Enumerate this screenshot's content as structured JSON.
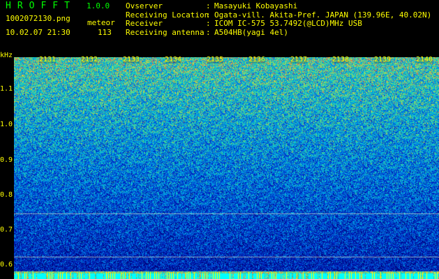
{
  "header": {
    "app_title": "HROFFT",
    "version": "1.0.0",
    "filename": "1002072130.png",
    "mode": "meteor",
    "datetime": "10.02.07 21:30",
    "count": "113"
  },
  "info": [
    {
      "label": "Ovserver",
      "colon": ":",
      "value": "Masayuki Kobayashi"
    },
    {
      "label": "Receiving Location",
      "colon": ":",
      "value": "Ogata-vill. Akita-Pref. JAPAN (139.96E, 40.02N)"
    },
    {
      "label": "Receiver",
      "colon": ":",
      "value": "ICOM IC-575 53.7492(@LCD)MHz USB"
    },
    {
      "label": "Receiving antenna",
      "colon": ":",
      "value": "A504HB(yagi 4el)"
    }
  ],
  "axis": {
    "y_unit": "kHz",
    "y_ticks": [
      "1.1",
      "1.0",
      "0.9",
      "0.8",
      "0.7",
      "0.6"
    ],
    "x_ticks": [
      "2131",
      "2132",
      "2133",
      "2134",
      "2135",
      "2136",
      "2137",
      "2138",
      "2139",
      "2140"
    ]
  },
  "colors": {
    "green": "#00ff00",
    "yellow": "#ffff00",
    "noise_low": "#0a1a8c",
    "noise_high": "#7fd86a"
  }
}
